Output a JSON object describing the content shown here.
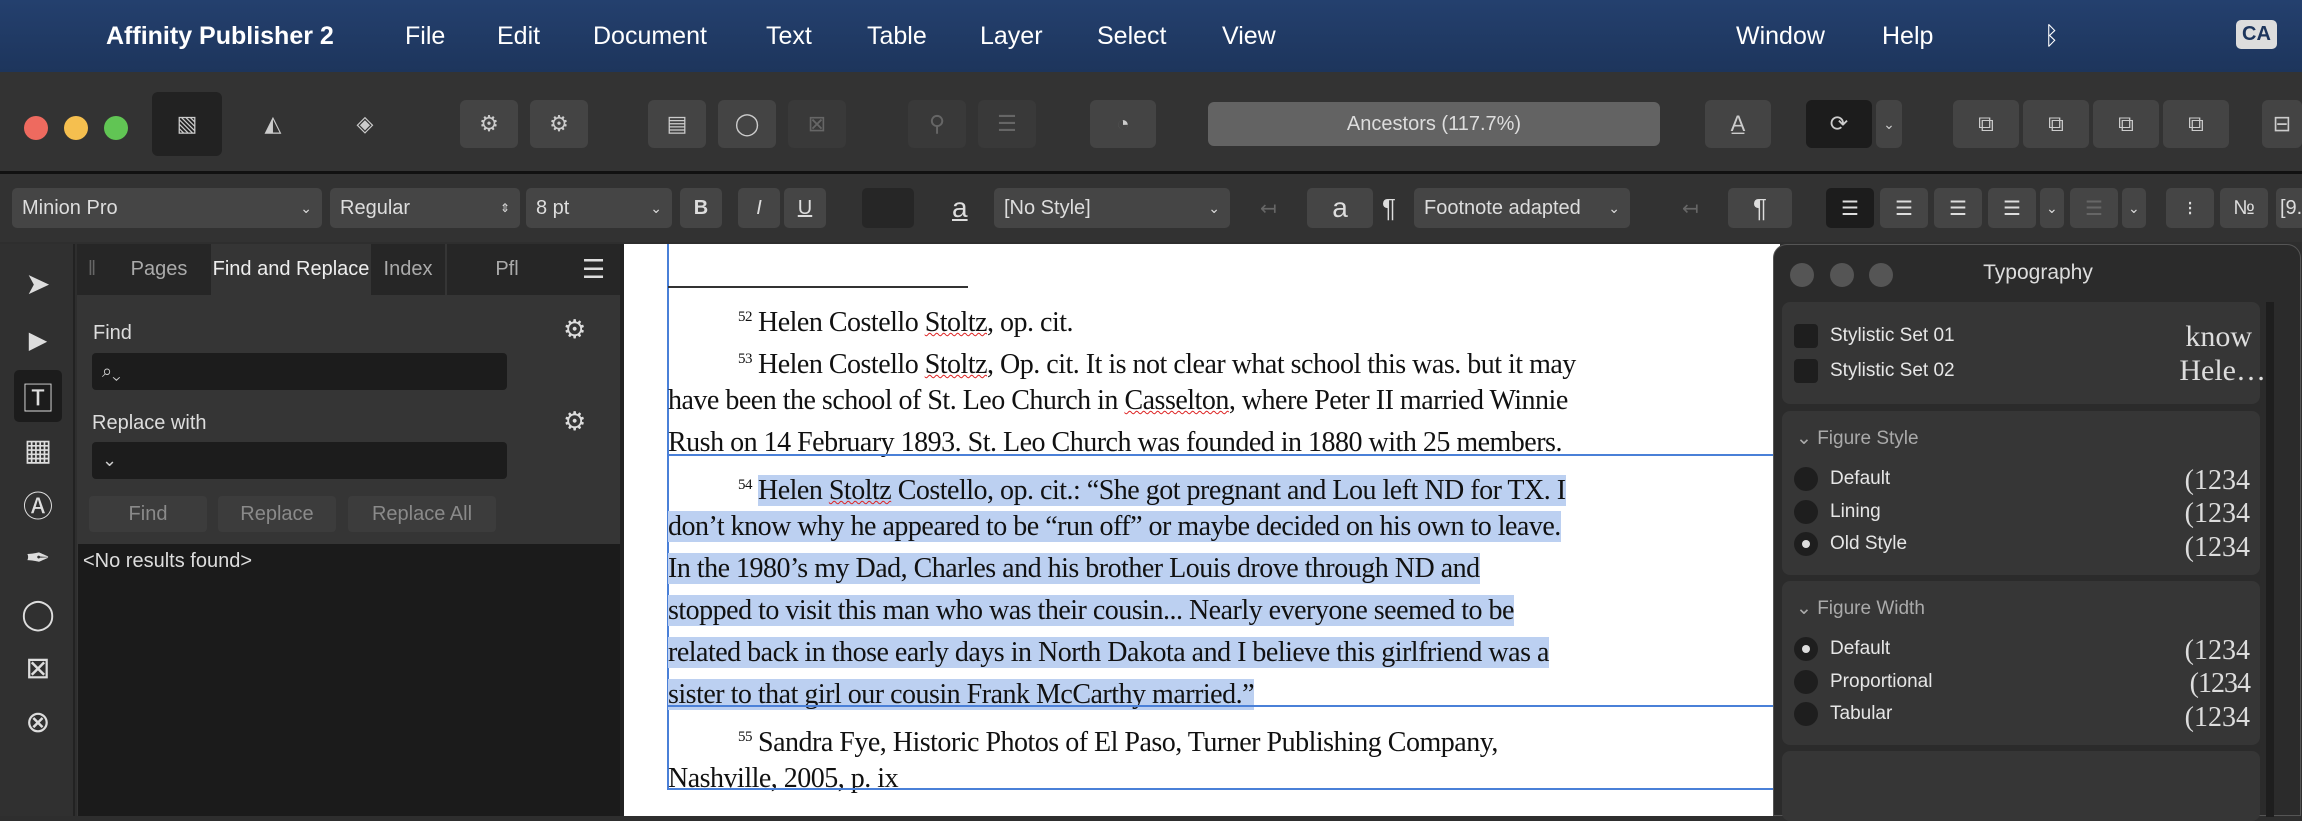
{
  "menubar": {
    "app": "Affinity Publisher 2",
    "items": [
      "File",
      "Edit",
      "Document",
      "Text",
      "Table",
      "Layer",
      "Select",
      "View"
    ],
    "window": "Window",
    "help": "Help",
    "user": "CA"
  },
  "toolbar": {
    "document_title": "Ancestors (117.7%)"
  },
  "formatbar": {
    "font": "Minion Pro",
    "weight": "Regular",
    "size": "8 pt",
    "bold": "B",
    "italic": "I",
    "underline": "U",
    "char_style": "[No Style]",
    "para_style": "Footnote adapted",
    "a_glyph": "a",
    "pilcrow": "¶",
    "trailing": "[9."
  },
  "panel": {
    "tabs": [
      "Pages",
      "Find and Replace",
      "Index",
      "Pfl"
    ],
    "find_label": "Find",
    "replace_label": "Replace with",
    "find_value": "",
    "replace_value": "",
    "buttons": [
      "Find",
      "Replace",
      "Replace All"
    ],
    "results": "<No results found>"
  },
  "document": {
    "n52": "52",
    "l1a": "Helen Costello ",
    "l1b": "Stoltz",
    ", ": "",
    "l1c": ", op. cit.",
    "n53": "53",
    "l2a": "Helen Costello ",
    "l2b": "Stoltz",
    "l2c": ", Op. cit. It is not clear what school this was. but it may",
    "l3a": "have been the school of St. Leo Church in ",
    "l3b": "Casselton",
    "l3c": ", where Peter II married Winnie",
    "l4": "Rush on 14 February 1893. St. Leo Church was founded in 1880 with 25 members.",
    "n54": "54",
    "l5a": "Helen ",
    "l5b": "Stoltz",
    "l5c": " Costello, op. cit.: “She got pregnant and Lou left ND for TX. I",
    "l6": "don’t know why he appeared to be “run off” or maybe decided on his own to leave.",
    "l7": "In the 1980’s my Dad, Charles and his brother Louis drove through ND and",
    "l8": "stopped to visit this man who was their cousin... Nearly everyone seemed to be",
    "l9": "related back in those early days in North Dakota and I believe this girlfriend was a",
    "l10": "sister to that girl our cousin Frank McCarthy married.”",
    "n55": "55",
    "l11": "Sandra Fye, Historic Photos of El Paso, Turner Publishing Company,",
    "l12": "Nashville, 2005, p. ix"
  },
  "typography": {
    "title": "Typography",
    "stylistic": [
      {
        "label": "Stylistic Set 01",
        "checked": false
      },
      {
        "label": "Stylistic Set 02",
        "checked": false
      }
    ],
    "stylistic_preview": [
      "know",
      "Hele…"
    ],
    "figure_style": {
      "title": "Figure Style",
      "options": [
        "Default",
        "Lining",
        "Old Style"
      ],
      "selected": "Old Style"
    },
    "figure_width": {
      "title": "Figure Width",
      "options": [
        "Default",
        "Proportional",
        "Tabular"
      ],
      "selected": "Default"
    },
    "preview": "(1234"
  },
  "colors": {
    "menubar": "#1f3a66",
    "selection": "#bcd0f1",
    "frame": "#4a80d8"
  }
}
